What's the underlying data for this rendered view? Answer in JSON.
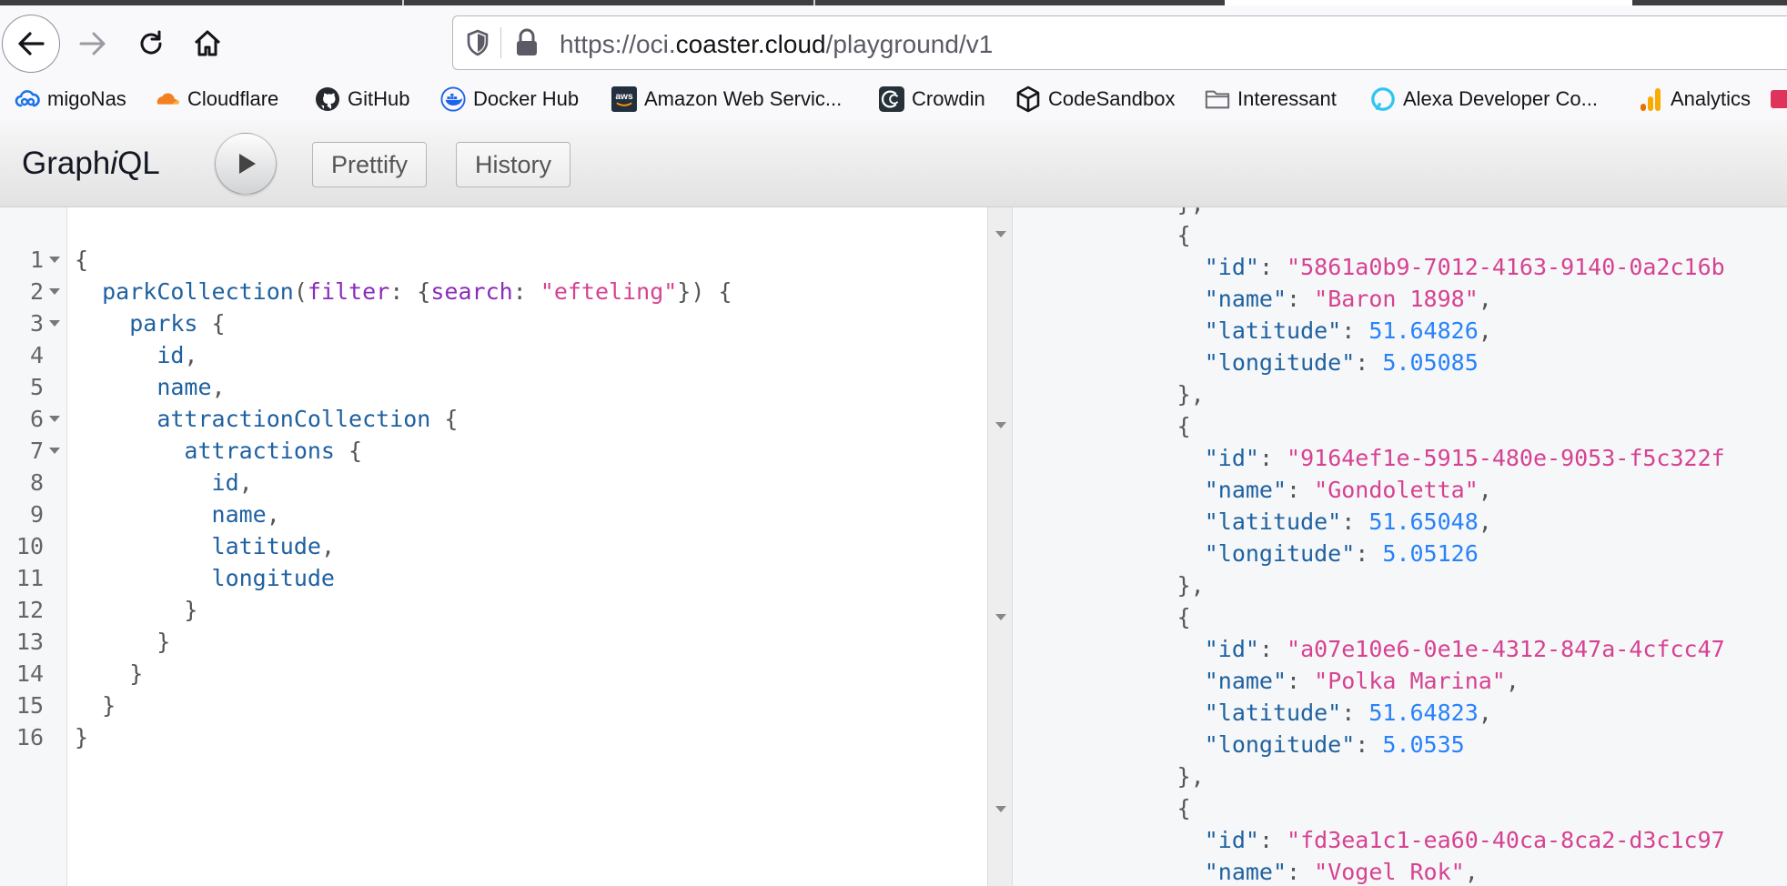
{
  "browser": {
    "url_scheme": "https://oci.",
    "url_host": "coaster.cloud",
    "url_path": "/playground/v1",
    "bookmarks": [
      {
        "label": "migoNas",
        "icon": "cloud-sync-icon",
        "color": "#1a73e8"
      },
      {
        "label": "Cloudflare",
        "icon": "cloudflare-icon",
        "color": "#f38020"
      },
      {
        "label": "GitHub",
        "icon": "github-icon",
        "color": "#24292e"
      },
      {
        "label": "Docker Hub",
        "icon": "docker-icon",
        "color": "#1d63ed"
      },
      {
        "label": "Amazon Web Servic...",
        "icon": "aws-icon",
        "color": "#232f3e"
      },
      {
        "label": "Crowdin",
        "icon": "crowdin-icon",
        "color": "#263238"
      },
      {
        "label": "CodeSandbox",
        "icon": "codesandbox-icon",
        "color": "#151515"
      },
      {
        "label": "Interessant",
        "icon": "folder-icon",
        "color": "#6b6b73"
      },
      {
        "label": "Alexa Developer Co...",
        "icon": "alexa-icon",
        "color": "#31c4f3"
      },
      {
        "label": "Analytics",
        "icon": "analytics-icon",
        "color": "#f9ab00"
      }
    ]
  },
  "graphiql": {
    "title_pre": "Graph",
    "title_i": "i",
    "title_post": "QL",
    "prettify_label": "Prettify",
    "history_label": "History"
  },
  "query": {
    "line_numbers": [
      "1",
      "2",
      "3",
      "4",
      "5",
      "6",
      "7",
      "8",
      "9",
      "10",
      "11",
      "12",
      "13",
      "14",
      "15",
      "16"
    ],
    "root_field": "parkCollection",
    "arg_filter": "filter",
    "arg_search": "search",
    "search_value": "\"efteling\"",
    "parks_field": "parks",
    "id_field": "id",
    "name_field": "name",
    "attraction_collection_field": "attractionCollection",
    "attractions_field": "attractions",
    "latitude_field": "latitude",
    "longitude_field": "longitude"
  },
  "result": {
    "key_id": "\"id\"",
    "key_name": "\"name\"",
    "key_latitude": "\"latitude\"",
    "key_longitude": "\"longitude\"",
    "items": [
      {
        "id": "\"5861a0b9-7012-4163-9140-0a2c16b",
        "name": "\"Baron 1898\"",
        "latitude": "51.64826",
        "longitude": "5.05085"
      },
      {
        "id": "\"9164ef1e-5915-480e-9053-f5c322f",
        "name": "\"Gondoletta\"",
        "latitude": "51.65048",
        "longitude": "5.05126"
      },
      {
        "id": "\"a07e10e6-0e1e-4312-847a-4cfcc47",
        "name": "\"Polka Marina\"",
        "latitude": "51.64823",
        "longitude": "5.0535"
      },
      {
        "id": "\"fd3ea1c1-ea60-40ca-8ca2-d3c1c97",
        "name": "\"Vogel Rok\""
      }
    ]
  }
}
